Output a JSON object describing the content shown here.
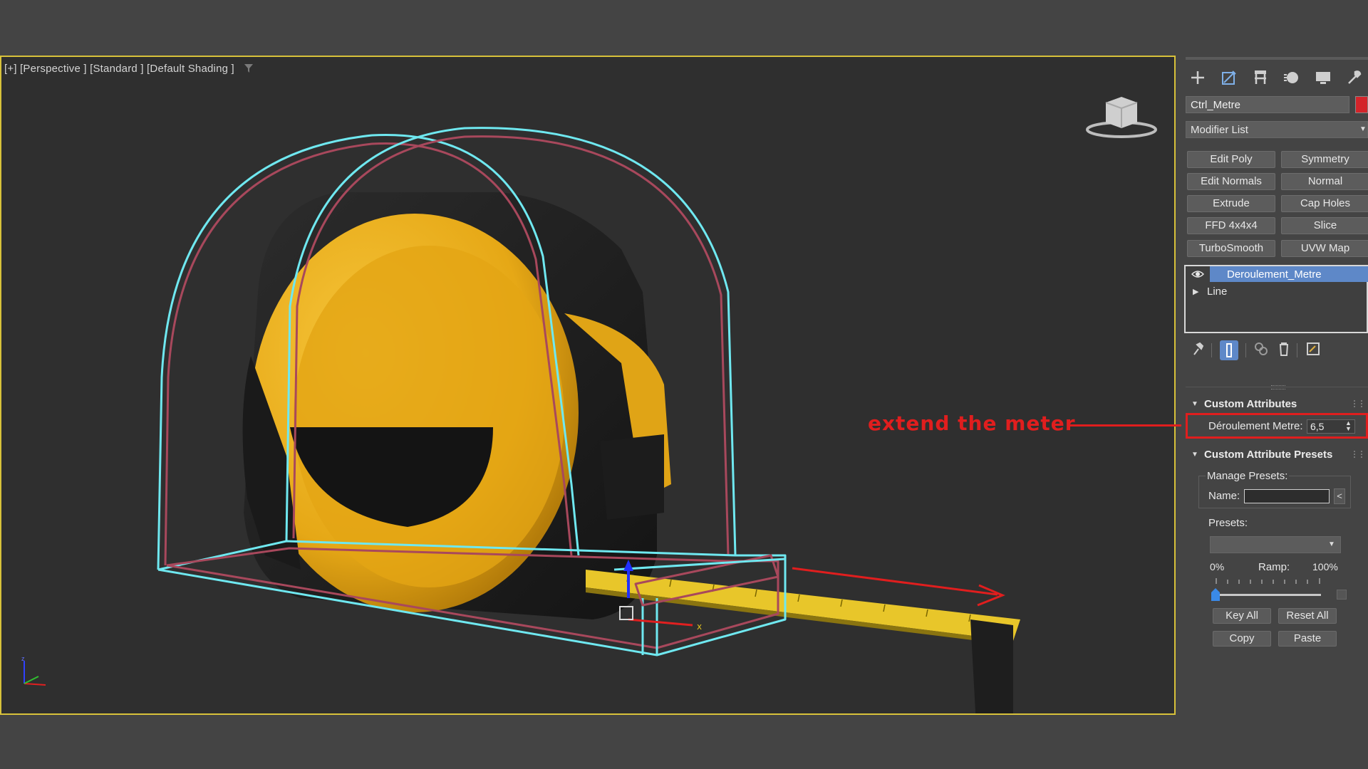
{
  "viewport": {
    "label": "[+] [Perspective ] [Standard ] [Default Shading ]"
  },
  "panel": {
    "tabs": [
      "create-tab",
      "modify-tab",
      "hierarchy-tab",
      "motion-tab",
      "display-tab",
      "utilities-tab"
    ],
    "object_name": "Ctrl_Metre",
    "object_color": "#d4242a",
    "modifier_list": "Modifier List",
    "modifier_buttons": [
      "Edit Poly",
      "Symmetry",
      "Edit Normals",
      "Normal",
      "Extrude",
      "Cap Holes",
      "FFD 4x4x4",
      "Slice",
      "TurboSmooth",
      "UVW Map"
    ],
    "stack": {
      "selected": "Deroulement_Metre",
      "base": "Line"
    },
    "custom_attributes": {
      "title": "Custom Attributes",
      "attr_label": "Déroulement Metre:",
      "attr_value": "6,5"
    },
    "presets": {
      "title": "Custom Attribute Presets",
      "manage_label": "Manage Presets:",
      "name_label": "Name:",
      "name_button": "<",
      "presets_label": "Presets:",
      "ramp_min": "0%",
      "ramp_label": "Ramp:",
      "ramp_max": "100%",
      "ramp_value": 0,
      "key_all": "Key All",
      "reset_all": "Reset All",
      "copy": "Copy",
      "paste": "Paste"
    }
  },
  "annotation": {
    "text": "extend the meter",
    "color": "#e01e1e"
  },
  "colors": {
    "accent_blue": "#5e88c8",
    "viewport_border": "#d8c23a",
    "tape_yellow": "#f2b21c",
    "wire_cyan": "#6fe8f0"
  }
}
